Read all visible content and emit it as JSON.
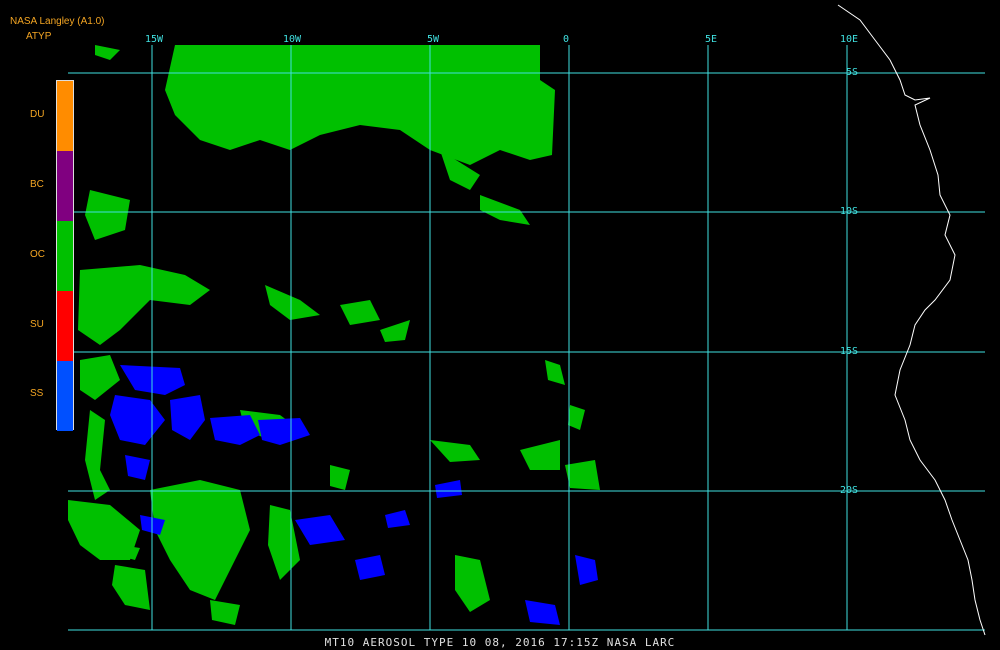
{
  "header": {
    "source": "NASA Langley (A1.0)",
    "product": "ATYP"
  },
  "legend": [
    {
      "code": "DU",
      "color": "#ff8c00"
    },
    {
      "code": "BC",
      "color": "#800080"
    },
    {
      "code": "OC",
      "color": "#00c000"
    },
    {
      "code": "SU",
      "color": "#ff0000"
    },
    {
      "code": "SS",
      "color": "#0050ff"
    }
  ],
  "longitude_labels": [
    "15W",
    "10W",
    "5W",
    "0",
    "5E",
    "10E"
  ],
  "latitude_labels": [
    "5S",
    "10S",
    "15S",
    "20S"
  ],
  "footer": {
    "caption": "MT10  AEROSOL TYPE   10 08, 2016 17:15Z   NASA LARC"
  },
  "colors": {
    "grid": "#40e0e0",
    "coast": "#ffffff",
    "oc": "#00c000",
    "ss": "#0000ff"
  }
}
